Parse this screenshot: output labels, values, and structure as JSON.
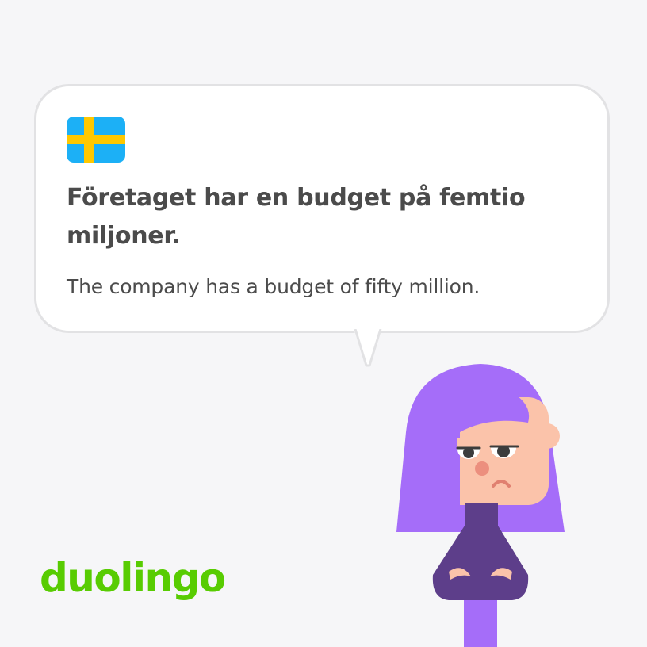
{
  "card": {
    "language_flag_icon": "sweden-flag-icon",
    "sentence": "Företaget har en budget på femtio miljoner.",
    "translation": "The company has a budget of fifty million."
  },
  "brand": {
    "logo_text": "duolingo",
    "logo_color": "#58cc02"
  },
  "character": {
    "icon": "lily-character-illustration",
    "hair_color": "#a56df9",
    "skin_color": "#fbc3aa",
    "shirt_color": "#5d3e8a"
  },
  "colors": {
    "background": "#f6f6f8",
    "bubble": "#ffffff",
    "bubble_border": "#e2e2e4",
    "text": "#4b4b4b",
    "flag_blue": "#1cb0f6",
    "flag_yellow": "#ffc800"
  }
}
